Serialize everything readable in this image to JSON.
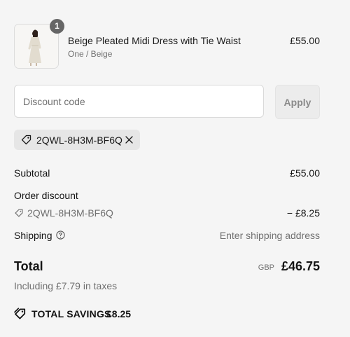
{
  "product": {
    "name": "Beige Pleated Midi Dress with Tie Waist",
    "variant": "One / Beige",
    "price": "£55.00",
    "quantity": "1"
  },
  "discount": {
    "placeholder": "Discount code",
    "value": "",
    "apply_label": "Apply",
    "applied_code": "2QWL-8H3M-BF6Q"
  },
  "summary": {
    "subtotal_label": "Subtotal",
    "subtotal_value": "£55.00",
    "order_discount_label": "Order discount",
    "order_discount_code": "2QWL-8H3M-BF6Q",
    "order_discount_value": "− £8.25",
    "shipping_label": "Shipping",
    "shipping_value": "Enter shipping address",
    "total_label": "Total",
    "currency": "GBP",
    "total_value": "£46.75",
    "taxes_note": "Including £7.79 in taxes",
    "savings_label": "TOTAL SAVINGS",
    "savings_value": "£8.25"
  },
  "colors": {
    "background": "#f5f5f5",
    "badge": "#666666",
    "muted_text": "#707070"
  },
  "icons": {
    "tag": "tag-icon",
    "remove": "close-icon",
    "help": "help-icon",
    "savings": "savings-tag-icon"
  }
}
